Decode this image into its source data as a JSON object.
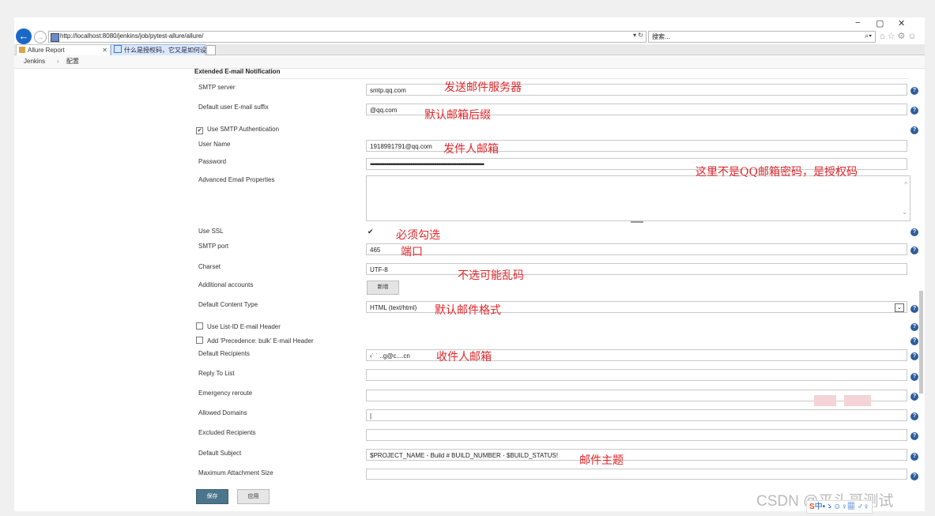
{
  "browser": {
    "window_controls": {
      "minimize": "−",
      "restore": "▢",
      "close": "✕"
    },
    "address": "http://localhost:8080/jenkins/job/pytest-allure/allure/",
    "address_tools": "▾ ↻",
    "search_placeholder": "搜索...",
    "search_icon": "⌕▾",
    "toolbar_icons": "⌂☆⚙☺",
    "tabs": [
      {
        "label": "Allure Report",
        "close": "✕"
      },
      {
        "label": "什么是授权码，它又是如何设..."
      }
    ]
  },
  "breadcrumb": {
    "root": "Jenkins",
    "sep": "›",
    "current": "配置"
  },
  "section_title": "Extended E-mail Notification",
  "form": {
    "smtp_server": {
      "label": "SMTP server",
      "value": "smtp.qq.com"
    },
    "default_suffix": {
      "label": "Default user E-mail suffix",
      "value": "@qq.com"
    },
    "use_smtp_auth": {
      "label": "Use SMTP Authentication",
      "checked": "✔"
    },
    "user_name": {
      "label": "User Name",
      "value": "1918991791@qq.com"
    },
    "password": {
      "label": "Password",
      "value": "••••••••••••••••••••••••••••••••••••••••••••••••••••••••••••••••••••••••••••••••••"
    },
    "advanced_props": {
      "label": "Advanced Email Properties",
      "scroll_up": "^",
      "scroll_down": "⌄"
    },
    "use_ssl": {
      "label": "Use SSL",
      "checked": "✔"
    },
    "smtp_port": {
      "label": "SMTP port",
      "value": "465"
    },
    "charset": {
      "label": "Charset",
      "value": "UTF-8"
    },
    "additional_accounts": {
      "label": "Additional accounts",
      "button": "新增"
    },
    "content_type": {
      "label": "Default Content Type",
      "value": "HTML (text/html)",
      "arrow": "⌄"
    },
    "list_id": {
      "label": "Use List-ID E-mail Header"
    },
    "precedence": {
      "label": "Add 'Precedence: bulk' E-mail Header"
    },
    "recipients": {
      "label": "Default Recipients",
      "value": "‹˙ ˙ ..g@c....cn"
    },
    "reply_to": {
      "label": "Reply To List",
      "value": ""
    },
    "emergency": {
      "label": "Emergency reroute",
      "value": ""
    },
    "allowed_domains": {
      "label": "Allowed Domains",
      "value": "|"
    },
    "excluded": {
      "label": "Excluded Recipients",
      "value": ""
    },
    "subject": {
      "label": "Default Subject",
      "value": "$PROJECT_NAME - Build # BUILD_NUMBER - $BUILD_STATUS!"
    },
    "max_attach": {
      "label": "Maximum Attachment Size",
      "value": ""
    }
  },
  "help_icon": "?",
  "annotations": {
    "smtp": "发送邮件服务器",
    "suffix": "默认邮箱后缀",
    "user": "发件人邮箱",
    "password": "这里不是QQ邮箱密码，是授权码",
    "ssl": "必须勾选",
    "port": "端口",
    "charset": "不选可能乱码",
    "content": "默认邮件格式",
    "recipients": "收件人邮箱",
    "subject": "邮件主题"
  },
  "buttons": {
    "save": "保存",
    "apply": "应用"
  },
  "watermark": "CSDN @平头哥测试",
  "ime": {
    "logo": "S",
    "text": "中•ゝ☺♀▦ ♂♀"
  },
  "colors": {
    "annotation": "#e0262a",
    "help": "#2e5d9a",
    "save": "#4b758b",
    "back": "#1a68c8"
  }
}
